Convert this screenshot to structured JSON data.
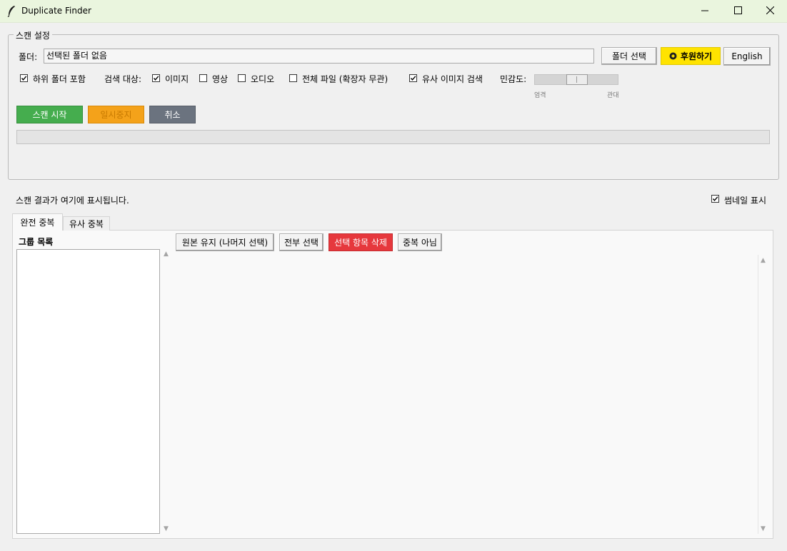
{
  "window": {
    "title": "Duplicate Finder",
    "controls": [
      "minimize",
      "maximize",
      "close"
    ]
  },
  "scan_settings": {
    "legend": "스캔 설정",
    "folder_label": "폴더:",
    "folder_value": "선택된 폴더 없음",
    "select_folder_button": "폴더 선택",
    "donate_button": "후원하기",
    "language_button": "English",
    "include_subfolders": {
      "label": "하위 폴더 포함",
      "checked": true
    },
    "search_target_label": "검색 대상:",
    "targets": [
      {
        "label": "이미지",
        "checked": true
      },
      {
        "label": "영상",
        "checked": false
      },
      {
        "label": "오디오",
        "checked": false
      },
      {
        "label": "전체 파일 (확장자 무관)",
        "checked": false
      },
      {
        "label": "유사 이미지 검색",
        "checked": true
      }
    ],
    "sensitivity_label": "민감도:",
    "sensitivity_min_label": "엄격",
    "sensitivity_max_label": "관대",
    "start_button": "스캔 시작",
    "pause_button": "일시중지",
    "cancel_button": "취소",
    "progress": 0
  },
  "results": {
    "status_text": "스캔 결과가 여기에 표시됩니다.",
    "thumbnail_toggle": {
      "label": "썸네일 표시",
      "checked": true
    },
    "tabs": [
      "완전 중복",
      "유사 중복"
    ],
    "active_tab": 0,
    "group_list_label": "그룹 목록",
    "actions": {
      "keep_original": "원본 유지 (나머지 선택)",
      "select_all": "전부 선택",
      "delete_selected": "선택 항목 삭제",
      "not_duplicate": "중복 아님"
    }
  },
  "colors": {
    "titlebar": "#eaf5de",
    "start": "#45ad4e",
    "pause": "#f4a21a",
    "cancel": "#6b737f",
    "delete": "#e6383d",
    "donate": "#ffe300"
  }
}
